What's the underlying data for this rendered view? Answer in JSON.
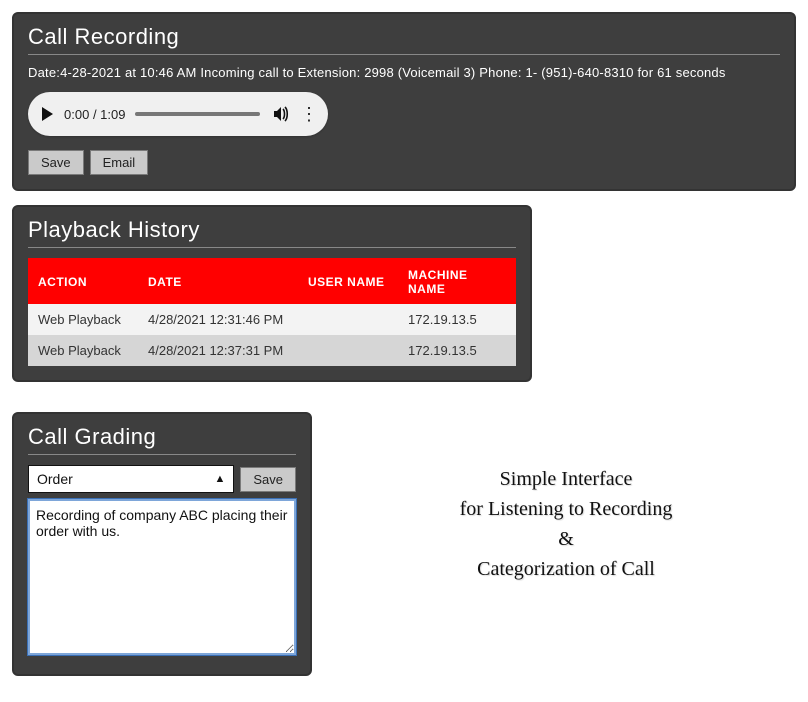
{
  "recording": {
    "title": "Call Recording",
    "details": "Date:4-28-2021 at 10:46 AM Incoming call to Extension: 2998 (Voicemail 3) Phone: 1- (951)-640-8310 for 61 seconds",
    "player": {
      "current_time": "0:00",
      "duration": "1:09"
    },
    "save_label": "Save",
    "email_label": "Email"
  },
  "playback": {
    "title": "Playback History",
    "columns": {
      "action": "ACTION",
      "date": "DATE",
      "user": "USER NAME",
      "machine": "MACHINE NAME"
    },
    "rows": [
      {
        "action": "Web Playback",
        "date": "4/28/2021 12:31:46 PM",
        "user": "",
        "machine": "172.19.13.5"
      },
      {
        "action": "Web Playback",
        "date": "4/28/2021 12:37:31 PM",
        "user": "",
        "machine": "172.19.13.5"
      }
    ]
  },
  "grading": {
    "title": "Call Grading",
    "selected_category": "Order",
    "save_label": "Save",
    "note_text": "Recording of company ABC placing their order with us."
  },
  "caption": {
    "line1": "Simple Interface",
    "line2": "for Listening to Recording",
    "line3": "&",
    "line4": "Categorization of Call"
  }
}
